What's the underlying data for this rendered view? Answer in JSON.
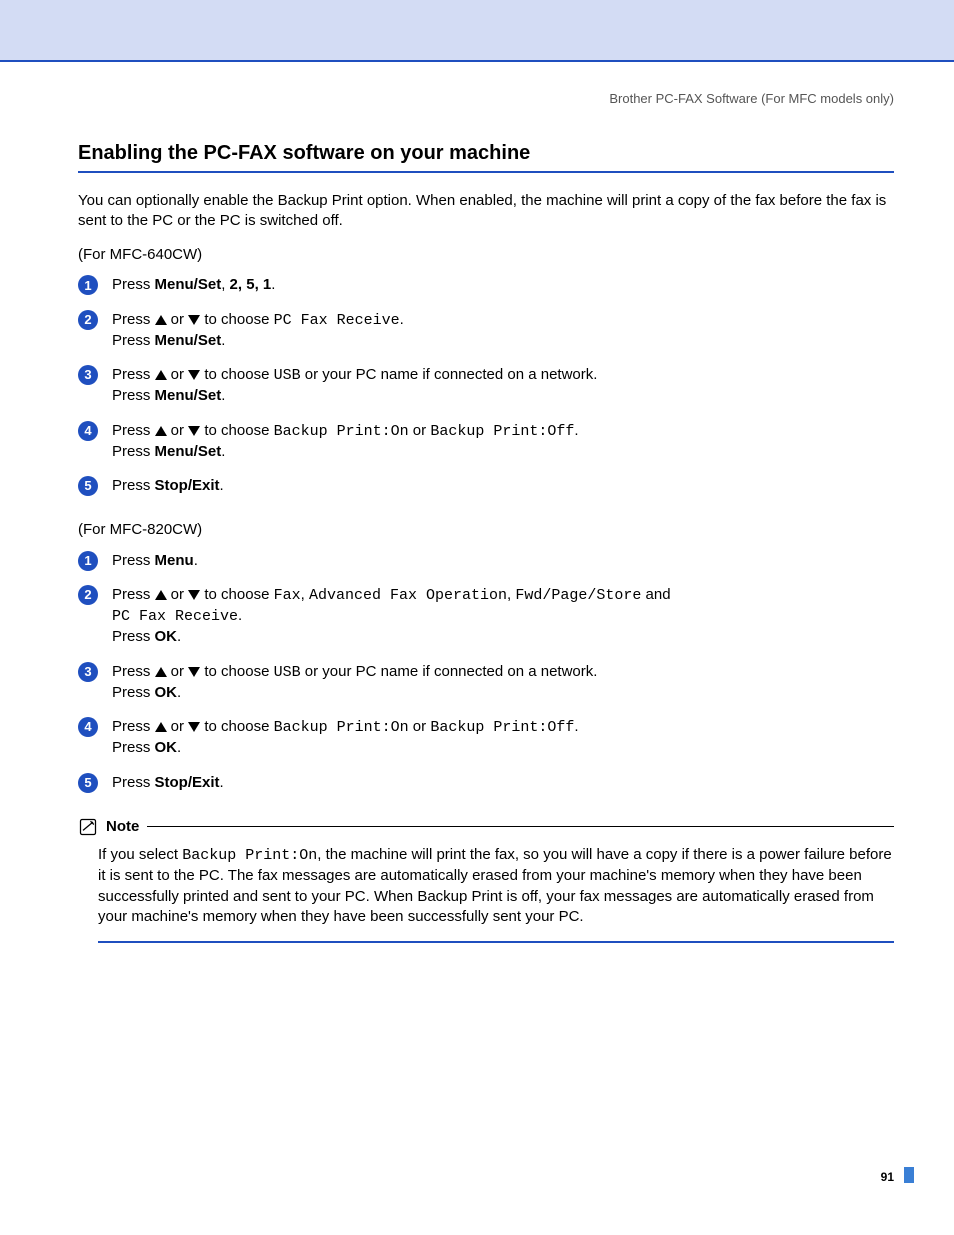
{
  "header": {
    "right": "Brother PC-FAX Software (For MFC models only)"
  },
  "title": "Enabling the PC-FAX software on your machine",
  "intro": "You can optionally enable the Backup Print option. When enabled, the machine will print a copy of the fax before the fax is sent to the PC or the PC is switched off.",
  "model_a": "(For  MFC-640CW)",
  "steps_a": {
    "s1": {
      "t1": "Press ",
      "b1": "Menu/Set",
      "t2": ", ",
      "b2": "2, 5, 1",
      "t3": "."
    },
    "s2": {
      "t1": "Press ",
      "t2": " or ",
      "t3": " to choose ",
      "m1": "PC Fax Receive",
      "t4": ".",
      "l2a": "Press ",
      "l2b": "Menu/Set",
      "l2c": "."
    },
    "s3": {
      "t1": "Press ",
      "t2": " or ",
      "t3": " to choose ",
      "m1": "USB",
      "t4": " or your PC name if connected on a network.",
      "l2a": "Press ",
      "l2b": "Menu/Set",
      "l2c": "."
    },
    "s4": {
      "t1": "Press ",
      "t2": " or ",
      "t3": " to choose ",
      "m1": "Backup Print:On",
      "t4": " or ",
      "m2": "Backup Print:Off",
      "t5": ".",
      "l2a": "Press ",
      "l2b": "Menu/Set",
      "l2c": "."
    },
    "s5": {
      "t1": "Press ",
      "b1": "Stop/Exit",
      "t2": "."
    }
  },
  "model_b": "(For MFC-820CW)",
  "steps_b": {
    "s1": {
      "t1": "Press ",
      "b1": "Menu",
      "t2": "."
    },
    "s2": {
      "t1": "Press ",
      "t2": " or ",
      "t3": " to choose ",
      "m1": "Fax",
      "t4": ", ",
      "m2": "Advanced Fax Operation",
      "t5": ", ",
      "m3": "Fwd/Page/Store",
      "t6": " and",
      "l2m": "PC Fax Receive",
      "l2t": ".",
      "l3a": "Press ",
      "l3b": "OK",
      "l3c": "."
    },
    "s3": {
      "t1": "Press ",
      "t2": " or ",
      "t3": " to choose ",
      "m1": "USB",
      "t4": " or your PC name if connected on a network.",
      "l2a": "Press ",
      "l2b": "OK",
      "l2c": "."
    },
    "s4": {
      "t1": "Press ",
      "t2": " or ",
      "t3": " to choose ",
      "m1": "Backup Print:On",
      "t4": " or ",
      "m2": "Backup Print:Off",
      "t5": ".",
      "l2a": "Press ",
      "l2b": "OK",
      "l2c": "."
    },
    "s5": {
      "t1": "Press ",
      "b1": "Stop/Exit",
      "t2": "."
    }
  },
  "note": {
    "title": "Note",
    "p1a": "If you select ",
    "p1m": "Backup Print:On",
    "p1b": ", the machine will print the fax, so you will have a copy if there is a power failure before it is sent to the PC. The fax messages are automatically erased from your machine's memory when they have been successfully printed and sent to your PC. When Backup Print is off, your fax messages are automatically erased from your machine's memory when they have been successfully sent your PC."
  },
  "pagenum": "91",
  "nums": {
    "n1": "1",
    "n2": "2",
    "n3": "3",
    "n4": "4",
    "n5": "5"
  }
}
